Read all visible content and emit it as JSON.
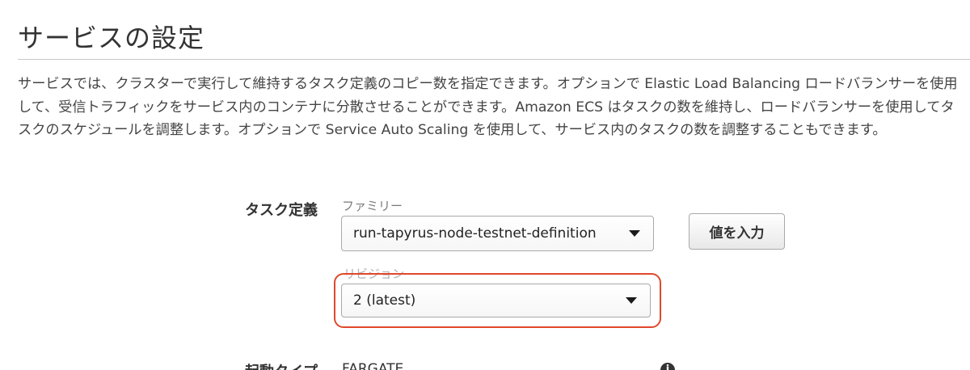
{
  "page": {
    "title": "サービスの設定",
    "description": "サービスでは、クラスターで実行して維持するタスク定義のコピー数を指定できます。オプションで Elastic Load Balancing ロードバランサーを使用して、受信トラフィックをサービス内のコンテナに分散させることができます。Amazon ECS はタスクの数を維持し、ロードバランサーを使用してタスクのスケジュールを調整します。オプションで Service Auto Scaling を使用して、サービス内のタスクの数を調整することもできます。"
  },
  "task_definition": {
    "label": "タスク定義",
    "family_label": "ファミリー",
    "family_value": "run-tapyrus-node-testnet-definition",
    "enter_value_button": "値を入力",
    "revision_label": "リビジョン",
    "revision_value": "2 (latest)"
  },
  "launch_type": {
    "label": "起動タイプ",
    "value": "FARGATE",
    "info_icon": "info-icon"
  },
  "colors": {
    "highlight": "#e0482b"
  }
}
